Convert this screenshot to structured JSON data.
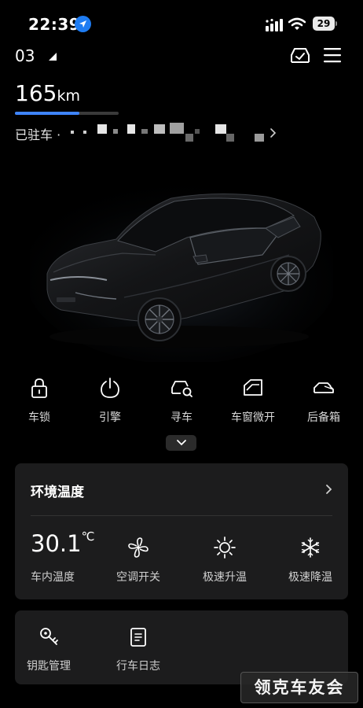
{
  "status_bar": {
    "time": "22:39",
    "battery": "29"
  },
  "header": {
    "vehicle_name": "03"
  },
  "range": {
    "value": "165",
    "unit": "km",
    "level": 0.62
  },
  "parking": {
    "status": "已驻车 ·"
  },
  "quick_actions": [
    {
      "label": "车锁",
      "icon": "lock-icon"
    },
    {
      "label": "引擎",
      "icon": "power-icon"
    },
    {
      "label": "寻车",
      "icon": "find-car-icon"
    },
    {
      "label": "车窗微开",
      "icon": "window-icon"
    },
    {
      "label": "后备箱",
      "icon": "trunk-icon"
    }
  ],
  "climate": {
    "title": "环境温度",
    "temperature": "30.1",
    "temperature_unit": "℃",
    "temperature_label": "车内温度",
    "features": [
      {
        "label": "空调开关",
        "icon": "fan-icon"
      },
      {
        "label": "极速升温",
        "icon": "sun-icon"
      },
      {
        "label": "极速降温",
        "icon": "snowflake-icon"
      }
    ]
  },
  "tools": [
    {
      "label": "钥匙管理",
      "icon": "key-icon"
    },
    {
      "label": "行车日志",
      "icon": "log-icon"
    }
  ],
  "watermark": "领克车友会",
  "colors": {
    "accent": "#3f85ff",
    "card": "#1c1c1d",
    "background": "#000000",
    "location": "#1e7cf2"
  }
}
